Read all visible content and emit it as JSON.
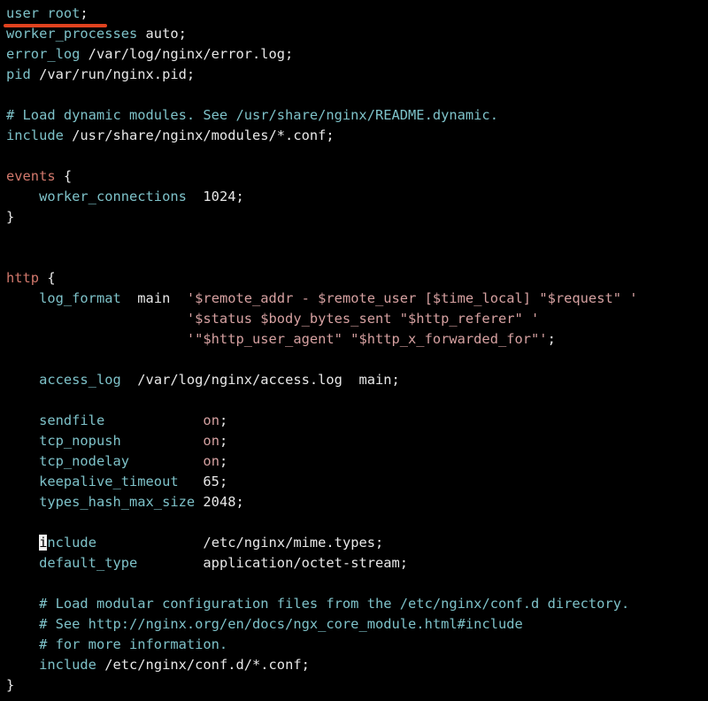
{
  "editor": {
    "lines": [
      {
        "tokens": [
          {
            "t": "user root",
            "c": "dir"
          },
          {
            "t": ";",
            "c": "txt"
          }
        ]
      },
      {
        "tokens": [
          {
            "t": "worker_processes",
            "c": "dir"
          },
          {
            "t": " auto;",
            "c": "txt"
          }
        ]
      },
      {
        "tokens": [
          {
            "t": "error_log",
            "c": "dir"
          },
          {
            "t": " /var/log/nginx/error.log;",
            "c": "txt"
          }
        ]
      },
      {
        "tokens": [
          {
            "t": "pid",
            "c": "dir"
          },
          {
            "t": " /var/run/nginx.pid;",
            "c": "txt"
          }
        ]
      },
      {
        "tokens": []
      },
      {
        "tokens": [
          {
            "t": "# Load dynamic modules. See /usr/share/nginx/README.dynamic.",
            "c": "com"
          }
        ]
      },
      {
        "tokens": [
          {
            "t": "include",
            "c": "dir"
          },
          {
            "t": " /usr/share/nginx/modules/*.conf;",
            "c": "txt"
          }
        ]
      },
      {
        "tokens": []
      },
      {
        "tokens": [
          {
            "t": "events",
            "c": "blk"
          },
          {
            "t": " {",
            "c": "txt"
          }
        ]
      },
      {
        "tokens": [
          {
            "t": "    ",
            "c": "txt"
          },
          {
            "t": "worker_connections",
            "c": "dir"
          },
          {
            "t": "  1024;",
            "c": "txt"
          }
        ]
      },
      {
        "tokens": [
          {
            "t": "}",
            "c": "txt"
          }
        ]
      },
      {
        "tokens": []
      },
      {
        "tokens": []
      },
      {
        "tokens": [
          {
            "t": "http",
            "c": "blk"
          },
          {
            "t": " {",
            "c": "txt"
          }
        ]
      },
      {
        "tokens": [
          {
            "t": "    ",
            "c": "txt"
          },
          {
            "t": "log_format",
            "c": "dir"
          },
          {
            "t": "  main  ",
            "c": "txt"
          },
          {
            "t": "'$remote_addr - $remote_user [$time_local] \"$request\" '",
            "c": "str"
          }
        ]
      },
      {
        "tokens": [
          {
            "t": "                      ",
            "c": "txt"
          },
          {
            "t": "'$status $body_bytes_sent \"$http_referer\" '",
            "c": "str"
          }
        ]
      },
      {
        "tokens": [
          {
            "t": "                      ",
            "c": "txt"
          },
          {
            "t": "'\"$http_user_agent\" \"$http_x_forwarded_for\"'",
            "c": "str"
          },
          {
            "t": ";",
            "c": "txt"
          }
        ]
      },
      {
        "tokens": []
      },
      {
        "tokens": [
          {
            "t": "    ",
            "c": "txt"
          },
          {
            "t": "access_log",
            "c": "dir"
          },
          {
            "t": "  /var/log/nginx/access.log  main;",
            "c": "txt"
          }
        ]
      },
      {
        "tokens": []
      },
      {
        "tokens": [
          {
            "t": "    ",
            "c": "txt"
          },
          {
            "t": "sendfile",
            "c": "dir"
          },
          {
            "t": "            ",
            "c": "txt"
          },
          {
            "t": "on",
            "c": "on"
          },
          {
            "t": ";",
            "c": "txt"
          }
        ]
      },
      {
        "tokens": [
          {
            "t": "    ",
            "c": "txt"
          },
          {
            "t": "tcp_nopush",
            "c": "dir"
          },
          {
            "t": "          ",
            "c": "txt"
          },
          {
            "t": "on",
            "c": "on"
          },
          {
            "t": ";",
            "c": "txt"
          }
        ]
      },
      {
        "tokens": [
          {
            "t": "    ",
            "c": "txt"
          },
          {
            "t": "tcp_nodelay",
            "c": "dir"
          },
          {
            "t": "         ",
            "c": "txt"
          },
          {
            "t": "on",
            "c": "on"
          },
          {
            "t": ";",
            "c": "txt"
          }
        ]
      },
      {
        "tokens": [
          {
            "t": "    ",
            "c": "txt"
          },
          {
            "t": "keepalive_timeout",
            "c": "dir"
          },
          {
            "t": "   65;",
            "c": "txt"
          }
        ]
      },
      {
        "tokens": [
          {
            "t": "    ",
            "c": "txt"
          },
          {
            "t": "types_hash_max_size",
            "c": "dir"
          },
          {
            "t": " 2048;",
            "c": "txt"
          }
        ]
      },
      {
        "tokens": []
      },
      {
        "tokens": [
          {
            "t": "    ",
            "c": "txt"
          },
          {
            "t": "i",
            "c": "cursor"
          },
          {
            "t": "nclude",
            "c": "dir"
          },
          {
            "t": "             /etc/nginx/mime.types;",
            "c": "txt"
          }
        ]
      },
      {
        "tokens": [
          {
            "t": "    ",
            "c": "txt"
          },
          {
            "t": "default_type",
            "c": "dir"
          },
          {
            "t": "        application/octet-stream;",
            "c": "txt"
          }
        ]
      },
      {
        "tokens": []
      },
      {
        "tokens": [
          {
            "t": "    ",
            "c": "txt"
          },
          {
            "t": "# Load modular configuration files from the /etc/nginx/conf.d directory.",
            "c": "com"
          }
        ]
      },
      {
        "tokens": [
          {
            "t": "    ",
            "c": "txt"
          },
          {
            "t": "# See http://nginx.org/en/docs/ngx_core_module.html#include",
            "c": "com"
          }
        ]
      },
      {
        "tokens": [
          {
            "t": "    ",
            "c": "txt"
          },
          {
            "t": "# for more information.",
            "c": "com"
          }
        ]
      },
      {
        "tokens": [
          {
            "t": "    ",
            "c": "txt"
          },
          {
            "t": "include",
            "c": "dir"
          },
          {
            "t": " /etc/nginx/conf.d/*.conf;",
            "c": "txt"
          }
        ]
      },
      {
        "tokens": [
          {
            "t": "}",
            "c": "txt"
          }
        ]
      }
    ]
  },
  "colors": {
    "background": "#000000",
    "text": "#e8e8e8",
    "directive": "#7ec2c9",
    "block": "#d2786c",
    "string": "#d6a1a1",
    "underline": "#e0421f"
  }
}
